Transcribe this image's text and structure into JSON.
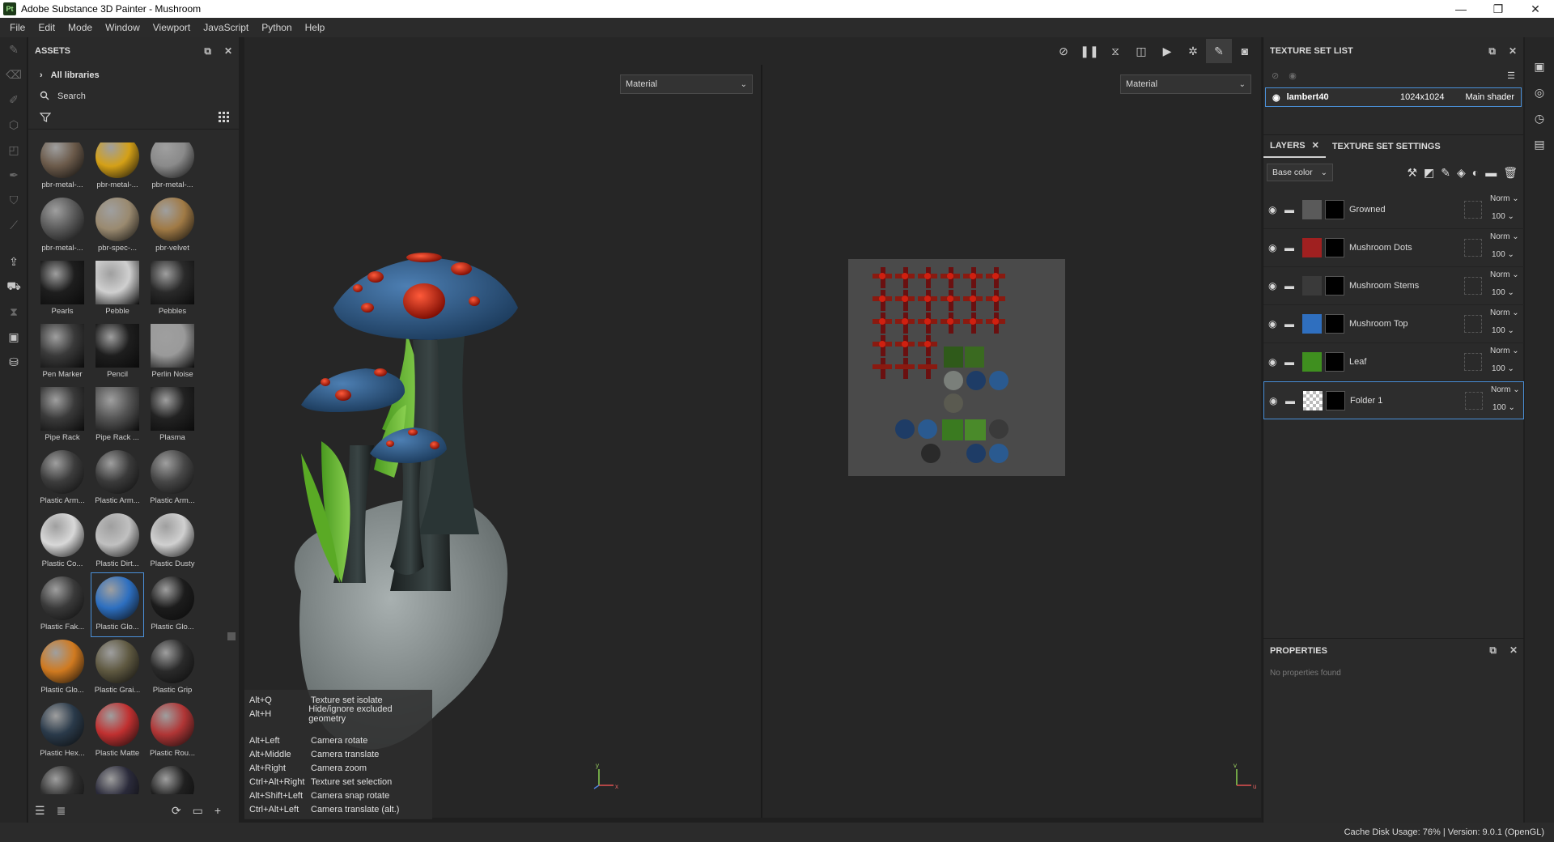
{
  "window": {
    "title": "Adobe Substance 3D Painter - Mushroom",
    "logo": "Pt"
  },
  "menu": [
    "File",
    "Edit",
    "Mode",
    "Window",
    "Viewport",
    "JavaScript",
    "Python",
    "Help"
  ],
  "assets": {
    "title": "ASSETS",
    "library": "All libraries",
    "search_placeholder": "Search",
    "rows": [
      [
        {
          "label": "pbr-metal-...",
          "color": "#6b5a4a"
        },
        {
          "label": "pbr-metal-...",
          "color": "#d4a017"
        },
        {
          "label": "pbr-metal-...",
          "color": "#8a8a8a"
        }
      ],
      [
        {
          "label": "pbr-metal-...",
          "color": "#5a5a5a"
        },
        {
          "label": "pbr-spec-...",
          "color": "#9a8a70"
        },
        {
          "label": "pbr-velvet",
          "color": "#a07a45"
        }
      ],
      [
        {
          "label": "Pearls",
          "color": "#1e1e1e"
        },
        {
          "label": "Pebble",
          "color": "#cfcfcf"
        },
        {
          "label": "Pebbles",
          "color": "#2a2a2a"
        }
      ],
      [
        {
          "label": "Pen Marker",
          "color": "#3a3a3a"
        },
        {
          "label": "Pencil",
          "color": "#1e1e1e"
        },
        {
          "label": "Perlin Noise",
          "color": "#9a9a9a"
        }
      ],
      [
        {
          "label": "Pipe Rack",
          "color": "#3a3a3a"
        },
        {
          "label": "Pipe Rack ...",
          "color": "#555555"
        },
        {
          "label": "Plasma",
          "color": "#222222"
        }
      ],
      [
        {
          "label": "Plastic Arm...",
          "color": "#3c3c3c"
        },
        {
          "label": "Plastic Arm...",
          "color": "#3a3a3a"
        },
        {
          "label": "Plastic Arm...",
          "color": "#464646"
        }
      ],
      [
        {
          "label": "Plastic Co...",
          "color": "#d8d8d8"
        },
        {
          "label": "Plastic Dirt...",
          "color": "#c0c0c0"
        },
        {
          "label": "Plastic Dusty",
          "color": "#d0d0d0"
        }
      ],
      [
        {
          "label": "Plastic Fak...",
          "color": "#3a3a3a"
        },
        {
          "label": "Plastic Glo...",
          "color": "#2d6fc0"
        },
        {
          "label": "Plastic Glo...",
          "color": "#1c1c1c"
        }
      ],
      [
        {
          "label": "Plastic Glo...",
          "color": "#d07a20"
        },
        {
          "label": "Plastic Grai...",
          "color": "#5e5840"
        },
        {
          "label": "Plastic Grip",
          "color": "#2a2a2a"
        }
      ],
      [
        {
          "label": "Plastic Hex...",
          "color": "#2a3a4a"
        },
        {
          "label": "Plastic Matte",
          "color": "#c03030"
        },
        {
          "label": "Plastic Rou...",
          "color": "#b03535"
        }
      ],
      [
        {
          "label": "",
          "color": "#303030"
        },
        {
          "label": "",
          "color": "#2a2a3a"
        },
        {
          "label": "",
          "color": "#202020"
        }
      ]
    ],
    "selected_row": 7,
    "selected_col": 1
  },
  "viewport": {
    "left_mode": "Material",
    "right_mode": "Material",
    "shortcuts_group1": [
      {
        "key": "Alt+Q",
        "action": "Texture set isolate"
      },
      {
        "key": "Alt+H",
        "action": "Hide/ignore excluded geometry"
      }
    ],
    "shortcuts_group2": [
      {
        "key": "Alt+Left",
        "action": "Camera rotate"
      },
      {
        "key": "Alt+Middle",
        "action": "Camera translate"
      },
      {
        "key": "Alt+Right",
        "action": "Camera zoom"
      },
      {
        "key": "Ctrl+Alt+Right",
        "action": "Texture set selection"
      },
      {
        "key": "Alt+Shift+Left",
        "action": "Camera snap rotate"
      },
      {
        "key": "Ctrl+Alt+Left",
        "action": "Camera translate (alt.)"
      }
    ],
    "axis_left_x": "x",
    "axis_left_y": "y",
    "axis_right_x": "u",
    "axis_right_y": "v"
  },
  "texture_set_list": {
    "title": "TEXTURE SET LIST",
    "name": "lambert40",
    "resolution": "1024x1024",
    "shader": "Main shader"
  },
  "layers": {
    "tab_layers": "LAYERS",
    "tab_settings": "TEXTURE SET SETTINGS",
    "channel": "Base color",
    "items": [
      {
        "name": "Growned",
        "color": "#5a5a5a",
        "blend": "Norm",
        "opacity": "100"
      },
      {
        "name": "Mushroom Dots",
        "color": "#a02020",
        "blend": "Norm",
        "opacity": "100"
      },
      {
        "name": "Mushroom Stems",
        "color": "#3a3a3a",
        "blend": "Norm",
        "opacity": "100"
      },
      {
        "name": "Mushroom Top",
        "color": "#2f6fbf",
        "blend": "Norm",
        "opacity": "100"
      },
      {
        "name": "Leaf",
        "color": "#3f8f1f",
        "blend": "Norm",
        "opacity": "100"
      },
      {
        "name": "Folder 1",
        "color": "#d0d0d0",
        "blend": "Norm",
        "opacity": "100"
      }
    ]
  },
  "properties": {
    "title": "PROPERTIES",
    "empty": "No properties found"
  },
  "status": {
    "text": "Cache Disk Usage:    76% | Version: 9.0.1 (OpenGL)"
  },
  "colors": {
    "accent": "#4a90d9",
    "mushroom_cap": "#2e5a8a",
    "mushroom_dot": "#c02010",
    "rock": "#8a8f8f",
    "leaf": "#6fbf30"
  }
}
